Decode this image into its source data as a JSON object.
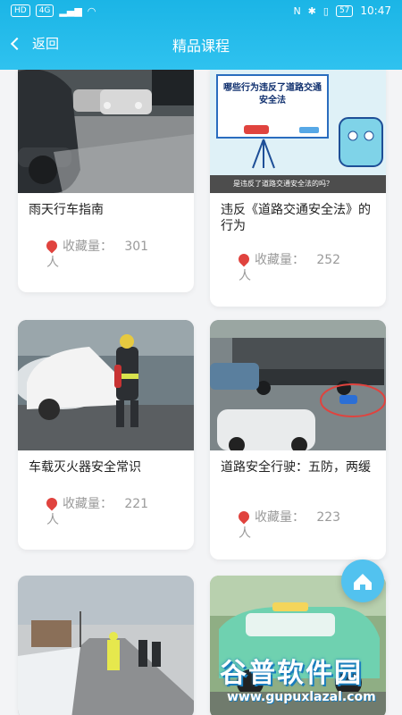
{
  "status_bar": {
    "left_chips": [
      "HD",
      "4G"
    ],
    "right_battery": "57",
    "time": "10:47"
  },
  "nav": {
    "back_label": "返回",
    "title": "精品课程"
  },
  "courses": [
    {
      "title": "雨天行车指南",
      "fav_label": "收藏量：",
      "fav_count": "301",
      "fav_unit": "人",
      "image_text": ""
    },
    {
      "title": "违反《道路交通安全法》的行为",
      "fav_label": "收藏量：",
      "fav_count": "252",
      "fav_unit": "人",
      "image_text": "哪些行为违反了道路交通安全法",
      "image_caption": "是违反了道路交通安全法的吗？"
    },
    {
      "title": "车载灭火器安全常识",
      "fav_label": "收藏量：",
      "fav_count": "221",
      "fav_unit": "人",
      "image_text": ""
    },
    {
      "title": "道路安全行驶：五防，两缓",
      "fav_label": "收藏量：",
      "fav_count": "223",
      "fav_unit": "人",
      "image_text": ""
    },
    {
      "title": "",
      "fav_label": "",
      "fav_count": "",
      "fav_unit": "",
      "image_text": ""
    },
    {
      "title": "",
      "fav_label": "",
      "fav_count": "",
      "fav_unit": "",
      "image_text": ""
    }
  ],
  "watermark": {
    "main": "谷普软件园",
    "sub": "www.gupuxlazal.com"
  },
  "colors": {
    "header": "#2fc2ef",
    "accent_red": "#e0433e"
  }
}
